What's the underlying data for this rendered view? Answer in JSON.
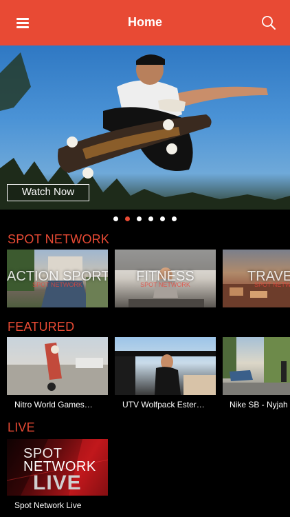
{
  "header": {
    "title": "Home",
    "menu_icon": "hamburger-menu-icon",
    "search_icon": "search-icon",
    "bg_color": "#e84a34"
  },
  "hero": {
    "button_label": "Watch Now",
    "dots": 6,
    "active_dot": 2
  },
  "sections": {
    "spot_network": {
      "title": "SPOT NETWORK",
      "tiles": [
        {
          "label": "ACTION SPORTS",
          "sub": "SPOT NETWORK"
        },
        {
          "label": "FITNESS",
          "sub": "SPOT NETWORK"
        },
        {
          "label": "TRAVE",
          "sub": "SPOT NETW"
        }
      ]
    },
    "featured": {
      "title": "FEATURED",
      "items": [
        {
          "caption": "Nitro World Games…"
        },
        {
          "caption": "UTV Wolfpack Ester…"
        },
        {
          "caption": "Nike SB - Nyjah"
        }
      ]
    },
    "live": {
      "title": "LIVE",
      "tile_line1": "SPOT",
      "tile_line2": "NETWORK",
      "tile_line3": "LIVE",
      "caption": "Spot Network Live"
    }
  },
  "colors": {
    "accent": "#e84a34",
    "background": "#000000"
  }
}
